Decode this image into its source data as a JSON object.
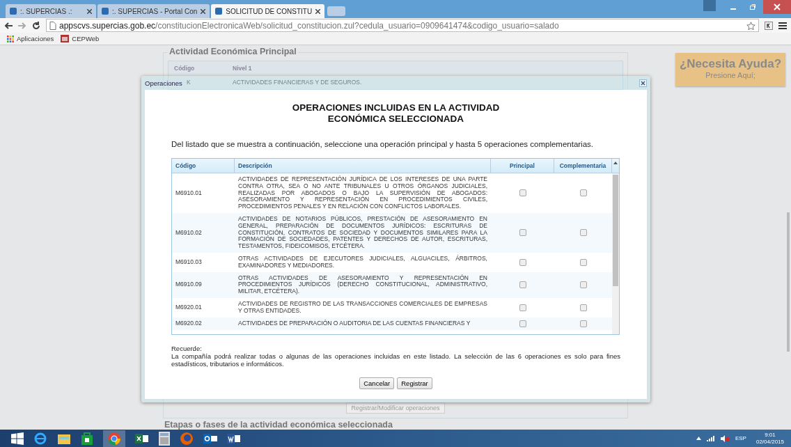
{
  "browser": {
    "tabs": [
      {
        "title": ":. SUPERCIAS .:",
        "selected": false
      },
      {
        "title": ":. SUPERCIAS - Portal Con",
        "selected": false
      },
      {
        "title": "SOLICITUD DE CONSTITU",
        "selected": true
      }
    ],
    "url_host": "appscvs.supercias.gob.ec",
    "url_path": "/constitucionElectronicaWeb/solicitud_constitucion.zul?cedula_usuario=0909641474&codigo_usuario=salado",
    "bookmarks": [
      "Aplicaciones",
      "CEPWeb"
    ]
  },
  "page": {
    "section_title": "Actividad Económica Principal",
    "columns": [
      "Código",
      "Nivel 1"
    ],
    "row": [
      "K",
      "ACTIVIDADES FINANCIERAS Y DE SEGUROS."
    ],
    "operations_button": "Registrar/Modificar operaciones",
    "stages_title": "Etapas o fases de la actividad económica seleccionada",
    "help": {
      "title": "¿Necesita Ayuda?",
      "subtitle": "Presione Aquí;"
    }
  },
  "dialog": {
    "title": "Operaciones",
    "heading": [
      "OPERACIONES INCLUIDAS EN LA ACTIVIDAD",
      "ECONÓMICA SELECCIONADA"
    ],
    "instructions": "Del listado que se muestra a continuación, seleccione una operación principal y hasta 5 operaciones complementarias.",
    "columns": [
      "Código",
      "Descripción",
      "Principal",
      "Complementaria"
    ],
    "rows": [
      {
        "code": "M6910.01",
        "description": "ACTIVIDADES DE REPRESENTACIÓN JURÍDICA DE LOS INTERESES DE UNA PARTE CONTRA OTRA, SEA O NO ANTE TRIBUNALES U OTROS ÓRGANOS JUDICIALES, REALIZADAS POR ABOGADOS O BAJO LA SUPERVISIÓN DE ABOGADOS: ASESORAMIENTO Y REPRESENTACIÓN EN PROCEDIMIENTOS CIVILES, PROCEDIMIENTOS PENALES Y EN RELACIÓN CON CONFLICTOS LABORALES.",
        "principal": false,
        "complementaria": false
      },
      {
        "code": "M6910.02",
        "description": "ACTIVIDADES DE NOTARIOS PÚBLICOS, PRESTACIÓN DE ASESORAMIENTO EN GENERAL, PREPARACIÓN DE DOCUMENTOS JURÍDICOS: ESCRITURAS DE CONSTITUCIÓN, CONTRATOS DE SOCIEDAD Y DOCUMENTOS SIMILARES PARA LA FORMACIÓN DE SOCIEDADES, PATENTES Y DERECHOS DE AUTOR, ESCRITURAS, TESTAMENTOS, FIDEICOMISOS, ETCÉTERA.",
        "principal": false,
        "complementaria": false
      },
      {
        "code": "M6910.03",
        "description": "OTRAS ACTIVIDADES DE EJECUTORES JUDICIALES, ALGUACILES, ÁRBITROS, EXAMINADORES Y MEDIADORES.",
        "principal": false,
        "complementaria": false
      },
      {
        "code": "M6910.09",
        "description": "OTRAS ACTIVIDADES DE ASESORAMIENTO Y REPRESENTACIÓN EN PROCEDIMIENTOS JURÍDICOS (DERECHO CONSTITUCIONAL, ADMINISTRATIVO, MILITAR, ETCÉTERA).",
        "principal": false,
        "complementaria": false
      },
      {
        "code": "M6920.01",
        "description": "ACTIVIDADES DE REGISTRO DE LAS TRANSACCIONES COMERCIALES DE EMPRESAS Y OTRAS ENTIDADES.",
        "principal": false,
        "complementaria": false
      },
      {
        "code": "M6920.02",
        "description": "ACTIVIDADES DE PREPARACIÓN O AUDITORIA DE LAS CUENTAS FINANCIERAS Y",
        "principal": false,
        "complementaria": false
      }
    ],
    "note_title": "Recuerde:",
    "note": "La compañía podrá realizar todas o algunas de las operaciones incluidas en este listado. La selección de las 6 operaciones es solo para fines estadísticos, tributarios e informáticos.",
    "buttons": [
      "Cancelar",
      "Registrar"
    ]
  },
  "taskbar": {
    "language": "ESP",
    "time": "9:01",
    "date": "02/04/2015"
  }
}
